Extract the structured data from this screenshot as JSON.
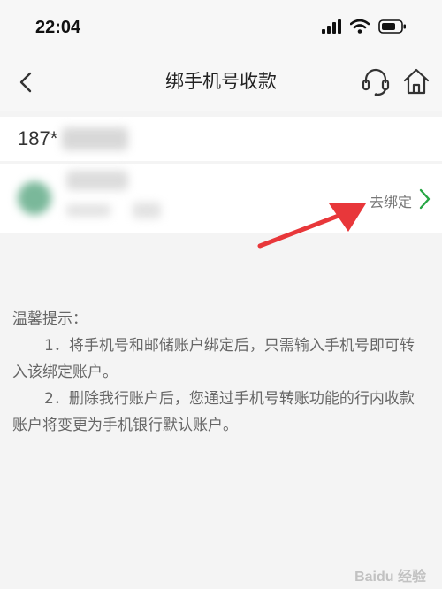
{
  "status": {
    "time": "22:04"
  },
  "nav": {
    "title": "绑手机号收款"
  },
  "phone": {
    "prefix": "187*"
  },
  "account": {
    "unbind_label": "去绑定"
  },
  "tips": {
    "title": "温馨提示：",
    "items": [
      "1．将手机号和邮储账户绑定后，只需输入手机号即可转入该绑定账户。",
      "2．删除我行账户后，您通过手机号转账功能的行内收款账户将变更为手机银行默认账户。"
    ]
  },
  "watermark": {
    "text": "Baidu 经验"
  },
  "colors": {
    "accent_green": "#27a644",
    "annotation_red": "#e8373a"
  }
}
